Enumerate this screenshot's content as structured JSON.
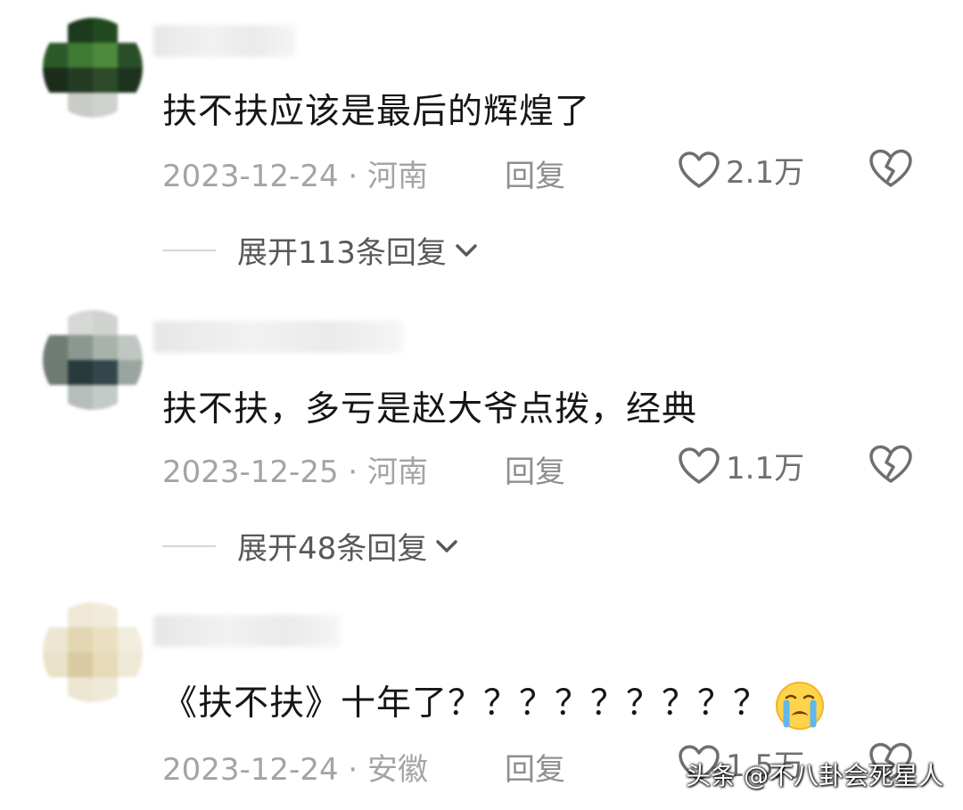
{
  "comments": [
    {
      "text": "扶不扶应该是最后的辉煌了",
      "meta": "2023-12-24 · 河南",
      "reply_label": "回复",
      "likes": "2.1万",
      "expand_label": "展开113条回复"
    },
    {
      "text": "扶不扶，多亏是赵大爷点拨，经典",
      "meta": "2023-12-25 · 河南",
      "reply_label": "回复",
      "likes": "1.1万",
      "expand_label": "展开48条回复"
    },
    {
      "text": "《扶不扶》十年了？？？？？？？？？",
      "meta": "2023-12-24 · 安徽",
      "reply_label": "回复",
      "likes": "1.5万"
    }
  ],
  "icons": {
    "like": "heart-outline-icon",
    "dislike": "broken-heart-icon",
    "expand": "chevron-down-icon",
    "emoji": "crying-face-emoji"
  },
  "watermark": "头条 @不八卦会死星人",
  "colors": {
    "text": "#161616",
    "meta": "#a4a4a4",
    "icon": "#6f6f6f"
  }
}
